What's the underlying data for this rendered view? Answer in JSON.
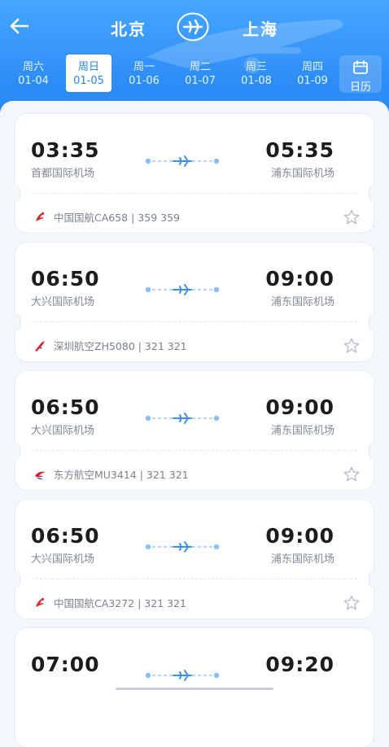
{
  "header": {
    "from_city": "北京",
    "to_city": "上海",
    "calendar_label": "日历",
    "colors": {
      "primary": "#2e8ef8",
      "selected_text": "#2a86f2"
    }
  },
  "dates": [
    {
      "weekday": "周六",
      "date": "01-04",
      "selected": false
    },
    {
      "weekday": "周日",
      "date": "01-05",
      "selected": true
    },
    {
      "weekday": "周一",
      "date": "01-06",
      "selected": false
    },
    {
      "weekday": "周二",
      "date": "01-07",
      "selected": false
    },
    {
      "weekday": "周三",
      "date": "01-08",
      "selected": false
    },
    {
      "weekday": "周四",
      "date": "01-09",
      "selected": false
    }
  ],
  "flights": [
    {
      "dep_time": "03:35",
      "dep_airport": "首都国际机场",
      "arr_time": "05:35",
      "arr_airport": "浦东国际机场",
      "airline_info": "中国国航CA658 | 359 359",
      "logo": "air-china-icon"
    },
    {
      "dep_time": "06:50",
      "dep_airport": "大兴国际机场",
      "arr_time": "09:00",
      "arr_airport": "浦东国际机场",
      "airline_info": "深圳航空ZH5080 | 321 321",
      "logo": "shenzhen-airlines-icon"
    },
    {
      "dep_time": "06:50",
      "dep_airport": "大兴国际机场",
      "arr_time": "09:00",
      "arr_airport": "浦东国际机场",
      "airline_info": "东方航空MU3414 | 321 321",
      "logo": "china-eastern-icon"
    },
    {
      "dep_time": "06:50",
      "dep_airport": "大兴国际机场",
      "arr_time": "09:00",
      "arr_airport": "浦东国际机场",
      "airline_info": "中国国航CA3272 | 321 321",
      "logo": "air-china-icon"
    },
    {
      "dep_time": "07:00",
      "dep_airport": "",
      "arr_time": "09:20",
      "arr_airport": "",
      "airline_info": "",
      "logo": ""
    }
  ]
}
